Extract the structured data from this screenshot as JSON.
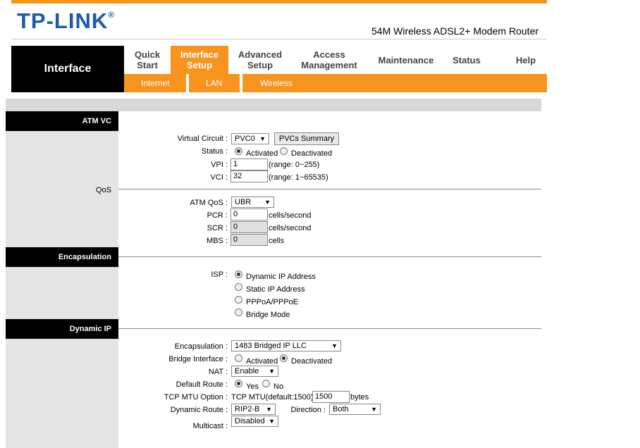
{
  "brand": {
    "logo": "TP-LINK",
    "model": "54M Wireless ADSL2+ Modem Router"
  },
  "nav": {
    "section_title": "Interface",
    "items": [
      {
        "label1": "Quick",
        "label2": "Start"
      },
      {
        "label1": "Interface",
        "label2": "Setup"
      },
      {
        "label1": "Advanced",
        "label2": "Setup"
      },
      {
        "label1": "Access",
        "label2": "Management"
      },
      {
        "label1": "Maintenance",
        "label2": ""
      },
      {
        "label1": "Status",
        "label2": ""
      },
      {
        "label1": "Help",
        "label2": ""
      }
    ],
    "sub_items": [
      "Internet",
      "LAN",
      "Wireless"
    ]
  },
  "sections": {
    "atm_vc": "ATM VC",
    "qos": "QoS",
    "encapsulation": "Encapsulation",
    "dynamic_ip": "Dynamic IP"
  },
  "atm": {
    "vc_label": "Virtual Circuit :",
    "vc_value": "PVC0",
    "pvcs_button": "PVCs Summary",
    "status_label": "Status :",
    "activated": "Activated",
    "deactivated": "Deactivated",
    "vpi_label": "VPI :",
    "vpi_value": "1",
    "vpi_range": "(range: 0~255)",
    "vci_label": "VCI :",
    "vci_value": "32",
    "vci_range": "(range: 1~65535)"
  },
  "qos": {
    "atm_qos_label": "ATM QoS :",
    "atm_qos_value": "UBR",
    "pcr_label": "PCR :",
    "pcr_value": "0",
    "pcr_unit": "cells/second",
    "scr_label": "SCR :",
    "scr_value": "0",
    "scr_unit": "cells/second",
    "mbs_label": "MBS :",
    "mbs_value": "0",
    "mbs_unit": "cells"
  },
  "encap": {
    "isp_label": "ISP :",
    "options": [
      "Dynamic IP Address",
      "Static IP Address",
      "PPPoA/PPPoE",
      "Bridge Mode"
    ]
  },
  "dynip": {
    "encap_label": "Encapsulation :",
    "encap_value": "1483 Bridged IP LLC",
    "bridge_label": "Bridge Interface :",
    "activated": "Activated",
    "deactivated": "Deactivated",
    "nat_label": "NAT :",
    "nat_value": "Enable",
    "route_label": "Default Route :",
    "yes": "Yes",
    "no": "No",
    "mtu_label": "TCP MTU Option :",
    "mtu_text": "TCP MTU(default:1500)",
    "mtu_value": "1500",
    "mtu_unit": "bytes",
    "dynroute_label": "Dynamic Route :",
    "dynroute_value": "RIP2-B",
    "direction_label": "Direction :",
    "direction_value": "Both",
    "multicast_label": "Multicast :",
    "multicast_value": "Disabled"
  }
}
